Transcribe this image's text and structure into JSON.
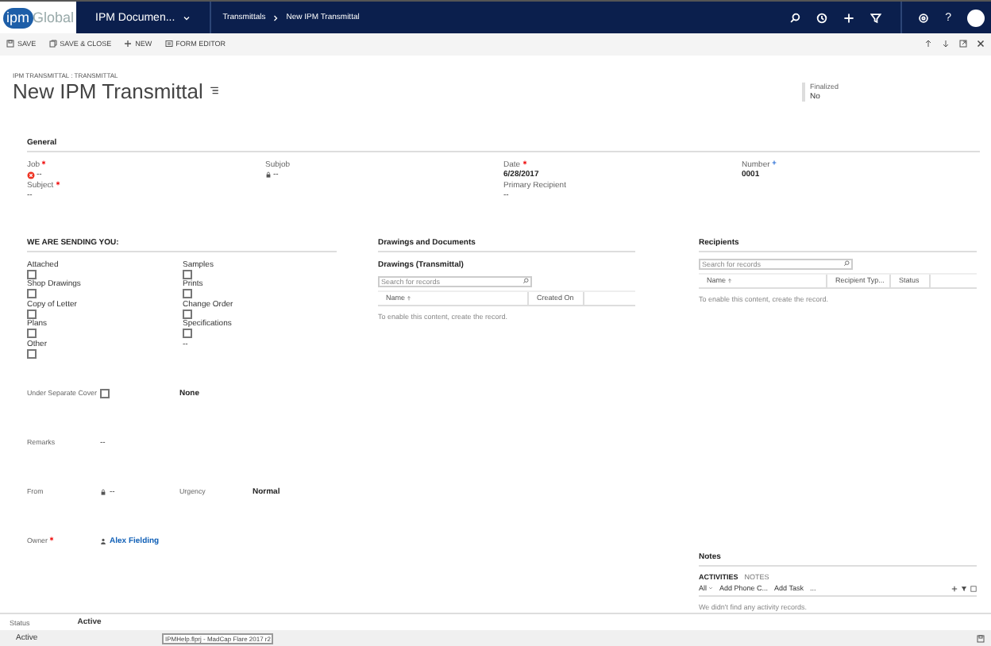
{
  "nav": {
    "logo_mark": "ipm",
    "logo_text": "Global",
    "app": "IPM Documen...",
    "breadcrumb": [
      {
        "label": "Transmittals"
      },
      {
        "label": "New IPM Transmittal"
      }
    ],
    "help": "?"
  },
  "commands": [
    {
      "kind": "save",
      "label": "SAVE"
    },
    {
      "kind": "save-close",
      "label": "SAVE & CLOSE"
    },
    {
      "kind": "new",
      "label": "NEW"
    },
    {
      "kind": "form-editor",
      "label": "FORM EDITOR"
    }
  ],
  "header": {
    "entity": "IPM TRANSMITTAL : TRANSMITTAL",
    "title": "New IPM Transmittal",
    "finalized": {
      "label": "Finalized",
      "value": "No"
    }
  },
  "general": {
    "heading": "General",
    "columns": [
      [
        {
          "label": "Job",
          "required": true,
          "recommended": false,
          "kind": "error",
          "value": "--"
        },
        {
          "label": "Subject",
          "required": true,
          "recommended": false,
          "kind": "plain",
          "value": "--"
        }
      ],
      [
        {
          "label": "Subjob",
          "required": false,
          "recommended": false,
          "kind": "locked",
          "value": "--"
        }
      ],
      [
        {
          "label": "Date",
          "required": true,
          "recommended": false,
          "kind": "bold",
          "value": "6/28/2017"
        },
        {
          "label": "Primary Recipient",
          "required": false,
          "recommended": false,
          "kind": "plain",
          "value": "--"
        }
      ],
      [
        {
          "label": "Number",
          "required": false,
          "recommended": true,
          "kind": "bold",
          "value": "0001"
        }
      ]
    ]
  },
  "sending": {
    "heading": "WE ARE SENDING YOU:",
    "columns": [
      [
        {
          "kind": "checkbox",
          "label": "Attached",
          "checked": false
        },
        {
          "kind": "checkbox",
          "label": "Shop Drawings",
          "checked": false
        },
        {
          "kind": "checkbox",
          "label": "Copy of Letter",
          "checked": false
        },
        {
          "kind": "checkbox",
          "label": "Plans",
          "checked": false
        },
        {
          "kind": "checkbox",
          "label": "Other",
          "checked": false
        }
      ],
      [
        {
          "kind": "checkbox",
          "label": "Samples",
          "checked": false
        },
        {
          "kind": "checkbox",
          "label": "Prints",
          "checked": false
        },
        {
          "kind": "checkbox",
          "label": "Change Order",
          "checked": false
        },
        {
          "kind": "checkbox",
          "label": "Specifications",
          "checked": false
        },
        {
          "kind": "value",
          "value": "--"
        }
      ]
    ]
  },
  "fields": [
    [
      {
        "label": "Under Separate Cover",
        "required": false,
        "kind": "checkbox",
        "checked": false
      },
      {
        "kind": "bold",
        "value": "None"
      }
    ],
    [
      {
        "label": "Remarks",
        "required": false,
        "kind": "plain",
        "value": "--"
      }
    ],
    [
      {
        "label": "From",
        "required": false,
        "kind": "locked",
        "value": "--"
      },
      {
        "label": "Urgency",
        "required": false,
        "kind": "bold",
        "value": "Normal"
      }
    ],
    [
      {
        "label": "Owner",
        "required": true,
        "kind": "link",
        "value": "Alex Fielding"
      }
    ]
  ],
  "drawings": {
    "heading": "Drawings and Documents",
    "title": "Drawings (Transmittal)",
    "search_placeholder": "Search for records",
    "columns": [
      {
        "label": "Name",
        "sorted": true
      },
      {
        "label": "Created On",
        "sorted": false
      }
    ],
    "empty": "To enable this content, create the record."
  },
  "recipients": {
    "heading": "Recipients",
    "search_placeholder": "Search for records",
    "columns": [
      {
        "label": "Name",
        "sorted": true
      },
      {
        "label": "Recipient Typ...",
        "sorted": false
      },
      {
        "label": "Status",
        "sorted": false
      }
    ],
    "empty": "To enable this content, create the record."
  },
  "notes": {
    "heading": "Notes",
    "tabs": [
      {
        "label": "ACTIVITIES",
        "selected": true
      },
      {
        "label": "NOTES",
        "selected": false
      }
    ],
    "filter": "All",
    "actions": [
      {
        "label": "Add Phone C..."
      },
      {
        "label": "Add Task"
      }
    ],
    "more": "...",
    "empty": "We didn't find any activity records."
  },
  "footer": {
    "status_label": "Status",
    "status_value": "Active",
    "bar_status": "Active",
    "tooltip": "IPMHelp.flprj - MadCap Flare 2017 r2"
  }
}
